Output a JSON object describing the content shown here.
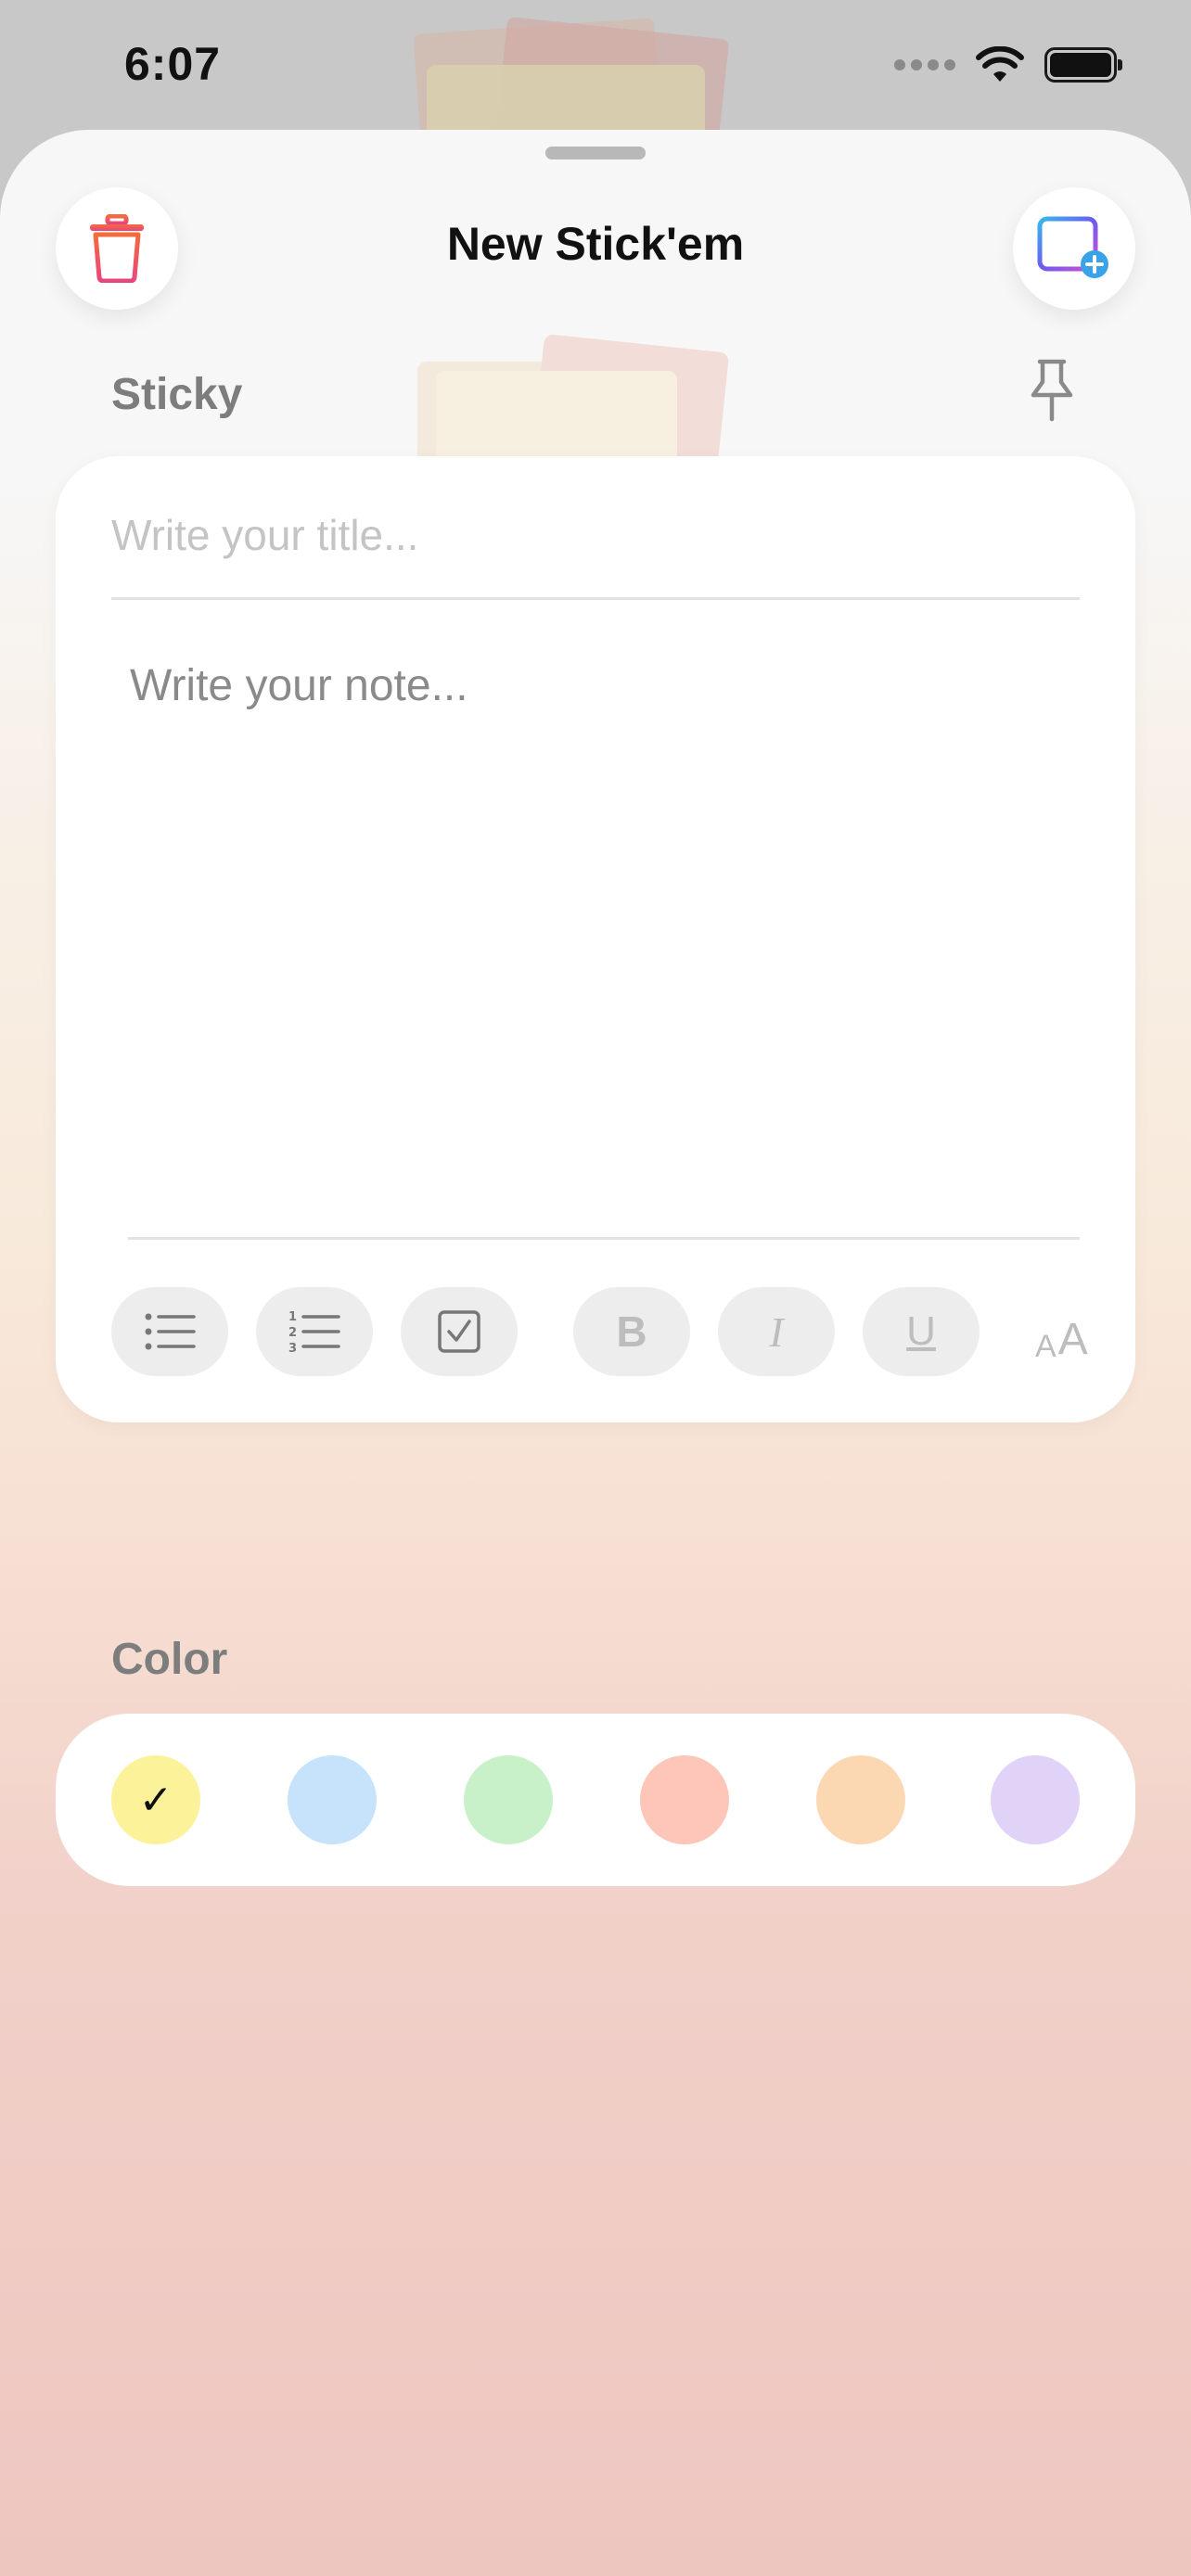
{
  "status_bar": {
    "time": "6:07"
  },
  "sheet": {
    "title": "New Stick'em"
  },
  "sticky_section": {
    "label": "Sticky"
  },
  "note": {
    "title_placeholder": "Write your title...",
    "body_placeholder": "Write your note..."
  },
  "toolbar": {
    "bold_label": "B",
    "italic_label": "I",
    "underline_label": "U",
    "font_size_small": "A",
    "font_size_large": "A"
  },
  "color_section": {
    "label": "Color",
    "selected_index": 0,
    "swatches": [
      {
        "name": "yellow",
        "hex": "#fbf29a"
      },
      {
        "name": "blue",
        "hex": "#c6e3fb"
      },
      {
        "name": "green",
        "hex": "#c8f1c9"
      },
      {
        "name": "red",
        "hex": "#fdc6b9"
      },
      {
        "name": "orange",
        "hex": "#fcd8b2"
      },
      {
        "name": "purple",
        "hex": "#e1d2f8"
      }
    ],
    "check_glyph": "✓"
  },
  "icons": {
    "trash": "trash-icon",
    "add_note": "add-note-icon",
    "pin": "pin-icon",
    "bulleted_list": "bulleted-list-icon",
    "numbered_list": "numbered-list-icon",
    "checklist": "checklist-icon"
  },
  "colors": {
    "accent_gradient": [
      "#f7a54a",
      "#e9457b",
      "#7b5cf5"
    ]
  }
}
